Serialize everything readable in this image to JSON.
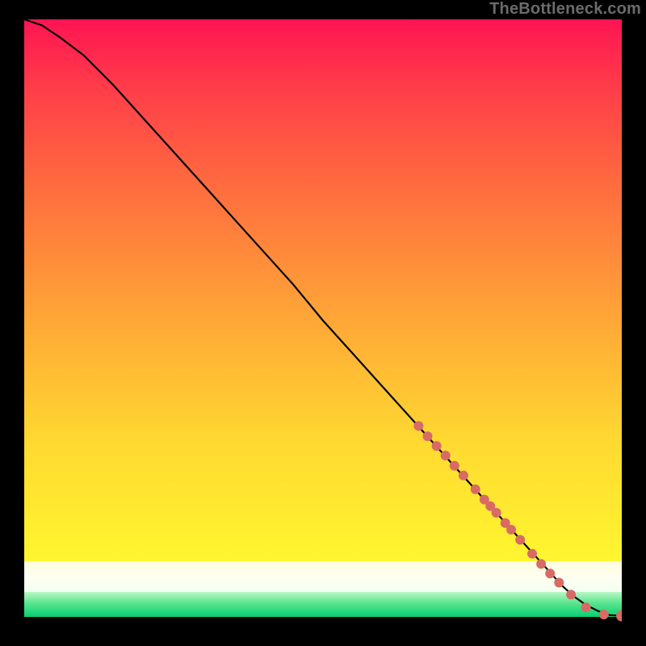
{
  "watermark": "TheBottleneck.com",
  "colors": {
    "curve": "#000000",
    "marker": "#d86b64",
    "bg_black": "#000000"
  },
  "chart_data": {
    "type": "line",
    "title": "",
    "xlabel": "",
    "ylabel": "",
    "xlim": [
      0,
      100
    ],
    "ylim": [
      0,
      100
    ],
    "grid": false,
    "legend": false,
    "series": [
      {
        "name": "bottleneck_curve",
        "x": [
          0,
          3,
          6,
          10,
          15,
          20,
          25,
          30,
          35,
          40,
          45,
          50,
          55,
          60,
          65,
          70,
          75,
          80,
          85,
          88,
          90,
          92,
          94,
          96,
          98,
          100
        ],
        "y": [
          100,
          99,
          97,
          94,
          89,
          83.5,
          78,
          72.5,
          67,
          61.5,
          56,
          50,
          44.5,
          39,
          33.5,
          28,
          22.5,
          17,
          11.5,
          8.2,
          6.0,
          4.2,
          2.8,
          1.8,
          1.1,
          1.0
        ]
      }
    ],
    "markers": {
      "name": "highlighted_points",
      "color": "#d86b64",
      "radius": 6,
      "points": [
        {
          "x": 66,
          "y": 32.5,
          "r": 6
        },
        {
          "x": 67.5,
          "y": 30.8,
          "r": 6
        },
        {
          "x": 69,
          "y": 29.2,
          "r": 6
        },
        {
          "x": 70.5,
          "y": 27.6,
          "r": 6
        },
        {
          "x": 72,
          "y": 25.9,
          "r": 6
        },
        {
          "x": 73.5,
          "y": 24.3,
          "r": 6
        },
        {
          "x": 75.5,
          "y": 22.0,
          "r": 6
        },
        {
          "x": 77,
          "y": 20.3,
          "r": 6
        },
        {
          "x": 78,
          "y": 19.2,
          "r": 6
        },
        {
          "x": 79,
          "y": 18.1,
          "r": 6
        },
        {
          "x": 80.5,
          "y": 16.4,
          "r": 6
        },
        {
          "x": 81.5,
          "y": 15.3,
          "r": 6
        },
        {
          "x": 83,
          "y": 13.6,
          "r": 6
        },
        {
          "x": 85,
          "y": 11.3,
          "r": 6
        },
        {
          "x": 86.5,
          "y": 9.6,
          "r": 6
        },
        {
          "x": 88,
          "y": 8.0,
          "r": 6
        },
        {
          "x": 89.5,
          "y": 6.5,
          "r": 6
        },
        {
          "x": 91.5,
          "y": 4.5,
          "r": 6
        },
        {
          "x": 94,
          "y": 2.4,
          "r": 6
        },
        {
          "x": 97,
          "y": 1.2,
          "r": 6
        },
        {
          "x": 100,
          "y": 1.0,
          "r": 7
        }
      ]
    },
    "gradient_bands": [
      {
        "name": "danger",
        "from_y": 10,
        "to_y": 100,
        "top_color": "#ff1452",
        "bottom_color": "#fff62f"
      },
      {
        "name": "neutral",
        "from_y": 5,
        "to_y": 10,
        "top_color": "#fffde0",
        "bottom_color": "#f2fff0"
      },
      {
        "name": "ok",
        "from_y": 1,
        "to_y": 5,
        "top_color": "#b9f7c7",
        "bottom_color": "#07cf72"
      }
    ]
  }
}
